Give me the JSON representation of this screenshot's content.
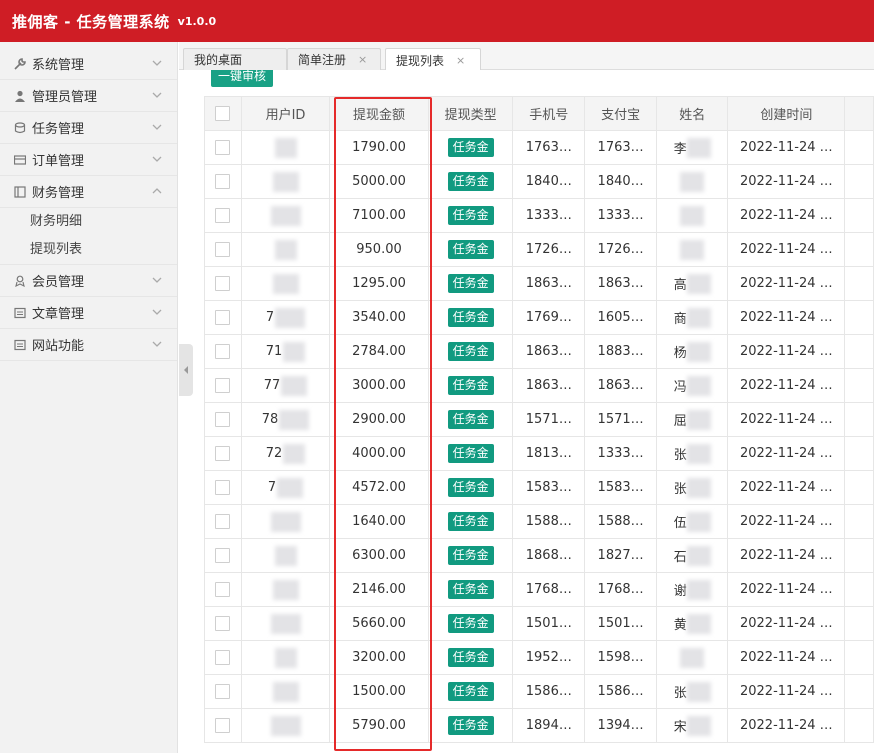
{
  "app": {
    "title": "推佣客 - 任务管理系统",
    "version": "v1.0.0"
  },
  "sidebar": {
    "items": [
      {
        "label": "系统管理",
        "icon": "wrench-icon"
      },
      {
        "label": "管理员管理",
        "icon": "user-icon"
      },
      {
        "label": "任务管理",
        "icon": "database-icon"
      },
      {
        "label": "订单管理",
        "icon": "card-icon"
      },
      {
        "label": "财务管理",
        "icon": "book-icon"
      }
    ],
    "finance_sub": [
      "财务明细",
      "提现列表"
    ],
    "items_after": [
      {
        "label": "会员管理",
        "icon": "member-icon"
      },
      {
        "label": "文章管理",
        "icon": "doc-icon"
      },
      {
        "label": "网站功能",
        "icon": "doc-icon"
      }
    ]
  },
  "tabs": [
    {
      "label": "我的桌面"
    },
    {
      "label": "简单注册",
      "close": "×"
    },
    {
      "label": "提现列表",
      "close": "×"
    }
  ],
  "toolbar": {
    "bulk_review": "一键审核"
  },
  "table": {
    "columns": [
      "用户ID",
      "提现金额",
      "提现类型",
      "手机号",
      "支付宝",
      "姓名",
      "创建时间"
    ],
    "rows": [
      {
        "uid": "",
        "amount": "1790.00",
        "type": "任务金",
        "phone": "1763…",
        "alipay": "1763…",
        "name": "李",
        "created": "2022-11-24 …"
      },
      {
        "uid": "",
        "amount": "5000.00",
        "type": "任务金",
        "phone": "1840…",
        "alipay": "1840…",
        "name": "",
        "created": "2022-11-24 …"
      },
      {
        "uid": "",
        "amount": "7100.00",
        "type": "任务金",
        "phone": "1333…",
        "alipay": "1333…",
        "name": "",
        "created": "2022-11-24 …"
      },
      {
        "uid": "",
        "amount": "950.00",
        "type": "任务金",
        "phone": "1726…",
        "alipay": "1726…",
        "name": "",
        "created": "2022-11-24 …"
      },
      {
        "uid": "",
        "amount": "1295.00",
        "type": "任务金",
        "phone": "1863…",
        "alipay": "1863…",
        "name": "高",
        "created": "2022-11-24 …"
      },
      {
        "uid": "7",
        "amount": "3540.00",
        "type": "任务金",
        "phone": "1769…",
        "alipay": "1605…",
        "name": "商",
        "created": "2022-11-24 …"
      },
      {
        "uid": "71",
        "amount": "2784.00",
        "type": "任务金",
        "phone": "1863…",
        "alipay": "1883…",
        "name": "杨",
        "created": "2022-11-24 …"
      },
      {
        "uid": "77",
        "amount": "3000.00",
        "type": "任务金",
        "phone": "1863…",
        "alipay": "1863…",
        "name": "冯",
        "created": "2022-11-24 …"
      },
      {
        "uid": "78",
        "amount": "2900.00",
        "type": "任务金",
        "phone": "1571…",
        "alipay": "1571…",
        "name": "屈",
        "created": "2022-11-24 …"
      },
      {
        "uid": "72",
        "amount": "4000.00",
        "type": "任务金",
        "phone": "1813…",
        "alipay": "1333…",
        "name": "张",
        "created": "2022-11-24 …"
      },
      {
        "uid": "7",
        "amount": "4572.00",
        "type": "任务金",
        "phone": "1583…",
        "alipay": "1583…",
        "name": "张",
        "created": "2022-11-24 …"
      },
      {
        "uid": "",
        "amount": "1640.00",
        "type": "任务金",
        "phone": "1588…",
        "alipay": "1588…",
        "name": "伍",
        "created": "2022-11-24 …"
      },
      {
        "uid": "",
        "amount": "6300.00",
        "type": "任务金",
        "phone": "1868…",
        "alipay": "1827…",
        "name": "石",
        "created": "2022-11-24 …"
      },
      {
        "uid": "",
        "amount": "2146.00",
        "type": "任务金",
        "phone": "1768…",
        "alipay": "1768…",
        "name": "谢",
        "created": "2022-11-24 …"
      },
      {
        "uid": "",
        "amount": "5660.00",
        "type": "任务金",
        "phone": "1501…",
        "alipay": "1501…",
        "name": "黄",
        "created": "2022-11-24 …"
      },
      {
        "uid": "",
        "amount": "3200.00",
        "type": "任务金",
        "phone": "1952…",
        "alipay": "1598…",
        "name": "",
        "created": "2022-11-24 …"
      },
      {
        "uid": "",
        "amount": "1500.00",
        "type": "任务金",
        "phone": "1586…",
        "alipay": "1586…",
        "name": "张",
        "created": "2022-11-24 …"
      },
      {
        "uid": "",
        "amount": "5790.00",
        "type": "任务金",
        "phone": "1894…",
        "alipay": "1394…",
        "name": "宋",
        "created": "2022-11-24 …"
      }
    ]
  },
  "colors": {
    "topbar": "#cf1d25",
    "tag": "#119a80",
    "highlight": "#e52a2a",
    "bulk_button": "#19a185"
  }
}
